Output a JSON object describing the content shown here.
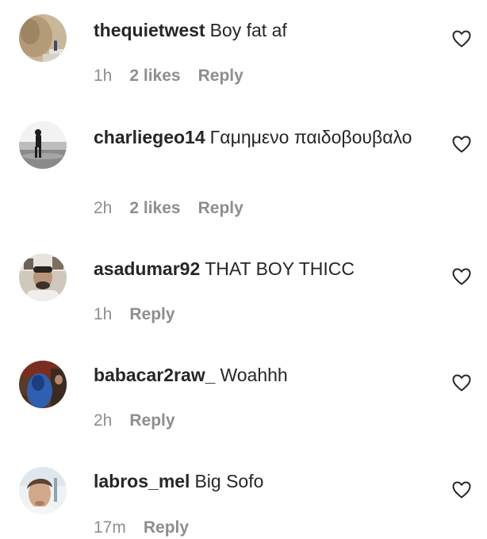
{
  "comments": [
    {
      "username": "thequietwest",
      "text": "Boy fat af",
      "time": "1h",
      "likes": "2 likes",
      "reply": "Reply",
      "avatar_icon": "avatar-rock-landscape"
    },
    {
      "username": "charliegeo14",
      "text": "Γαμημενο παιδοβουβαλο",
      "time": "2h",
      "likes": "2 likes",
      "reply": "Reply",
      "avatar_icon": "avatar-beach-person-bw"
    },
    {
      "username": "asadumar92",
      "text": "THAT BOY THICC",
      "time": "1h",
      "likes": null,
      "reply": "Reply",
      "avatar_icon": "avatar-man-portrait"
    },
    {
      "username": "babacar2raw_",
      "text": "Woahhh",
      "time": "2h",
      "likes": null,
      "reply": "Reply",
      "avatar_icon": "avatar-blue-figure"
    },
    {
      "username": "labros_mel",
      "text": "Big Sofo",
      "time": "17m",
      "likes": null,
      "reply": "Reply",
      "avatar_icon": "avatar-face-closeup"
    }
  ],
  "icons": {
    "like": "heart-outline-icon"
  },
  "colors": {
    "text_primary": "#262626",
    "text_secondary": "#8e8e8e",
    "background": "#ffffff"
  }
}
